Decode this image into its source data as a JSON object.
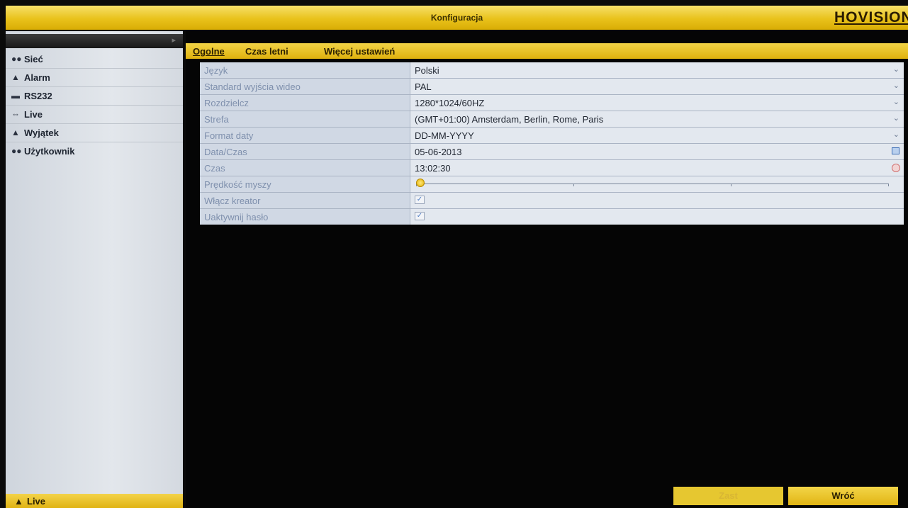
{
  "window": {
    "title": "Konfiguracja",
    "logo": "HOVISION"
  },
  "sidebar": {
    "selected_label": "",
    "items": [
      {
        "label": "Sieć",
        "icon": "network-icon"
      },
      {
        "label": "Alarm",
        "icon": "alarm-icon"
      },
      {
        "label": "RS232",
        "icon": "rs232-icon"
      },
      {
        "label": "Live",
        "icon": "live-icon"
      },
      {
        "label": "Wyjątek",
        "icon": "warning-icon"
      },
      {
        "label": "Użytkownik",
        "icon": "users-icon"
      }
    ],
    "footer_label": "Live"
  },
  "tabs": [
    {
      "label": "Ogolne",
      "active": true
    },
    {
      "label": "Czas letni",
      "active": false
    },
    {
      "label": "Więcej ustawień",
      "active": false
    }
  ],
  "form": {
    "rows": [
      {
        "label": "Język",
        "value": "Polski"
      },
      {
        "label": "Standard wyjścia wideo",
        "value": "PAL"
      },
      {
        "label": "Rozdzielcz",
        "value": "1280*1024/60HZ"
      },
      {
        "label": "Strefa",
        "value": "(GMT+01:00) Amsterdam, Berlin, Rome, Paris"
      },
      {
        "label": "Format daty",
        "value": "DD-MM-YYYY"
      },
      {
        "label": "Data/Czas",
        "value": "05-06-2013"
      },
      {
        "label": "Czas",
        "value": "13:02:30"
      },
      {
        "label": "Prędkość myszy",
        "value_fraction": 0.0
      },
      {
        "label": "Włącz kreator",
        "checked": true
      },
      {
        "label": "Uaktywnij hasło",
        "checked": true
      }
    ]
  },
  "buttons": {
    "apply": "Zast",
    "back": "Wróć"
  },
  "colors": {
    "accent": "#e9c21b",
    "form_bg": "#d3dbe6"
  }
}
